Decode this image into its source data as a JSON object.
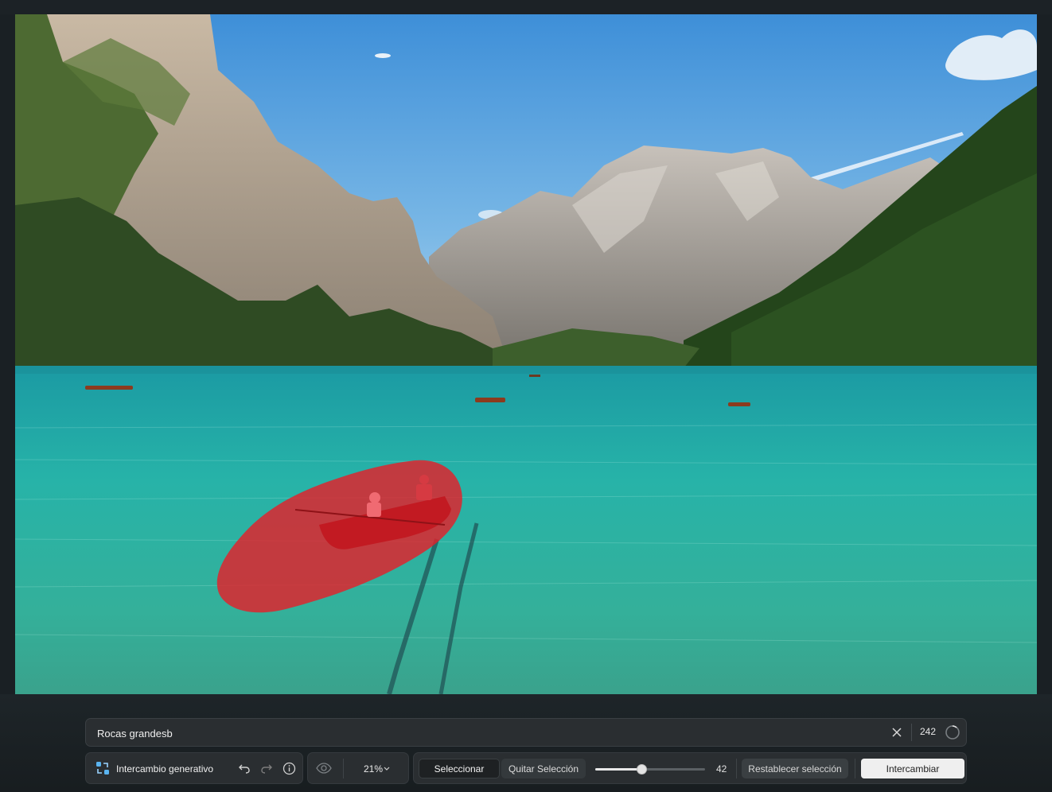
{
  "prompt": {
    "value": "Rocas grandesb",
    "placeholder": ""
  },
  "credits": {
    "count": "242"
  },
  "toolbar": {
    "tool_label": "Intercambio generativo",
    "zoom_label": "21%",
    "select_label": "Seleccionar",
    "deselect_label": "Quitar Selección",
    "brush_size": 42,
    "brush_size_label": "42",
    "brush_size_max": 100,
    "reset_label": "Restablecer selección",
    "swap_label": "Intercambiar"
  },
  "icons": {
    "tool": "generative-swap-icon",
    "undo": "undo-icon",
    "redo": "redo-icon",
    "info": "info-icon",
    "visibility": "eye-icon",
    "zoom_dropdown": "chevron-down-icon",
    "clear": "close-icon",
    "credits": "credits-ring-icon"
  },
  "colors": {
    "selection_mask": "#e4202a",
    "swap_button_bg": "#efefef",
    "accent": "#5ab4f0"
  }
}
